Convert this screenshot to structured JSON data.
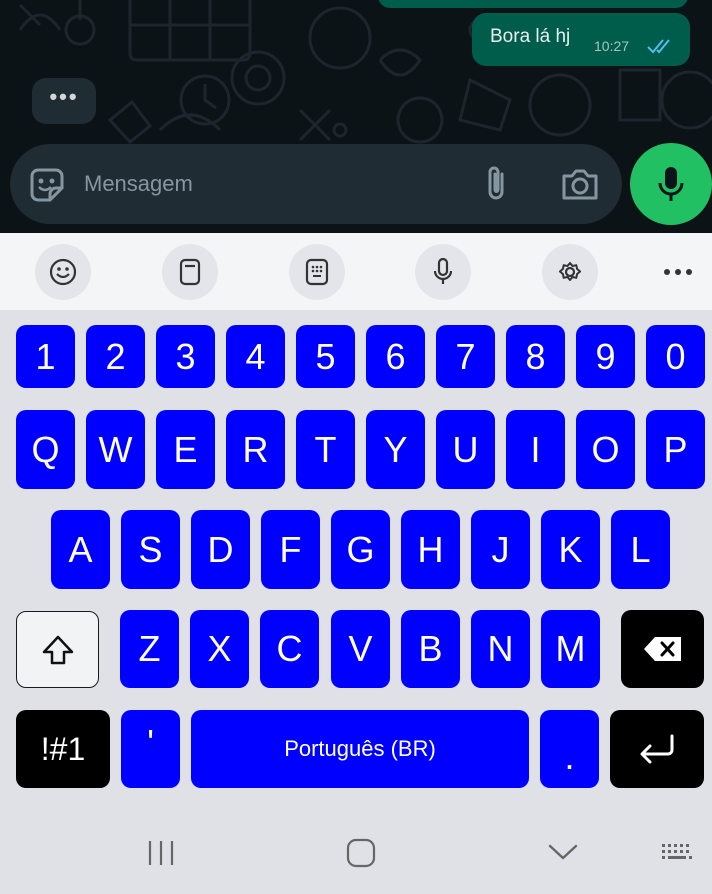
{
  "chat": {
    "outgoing_message": "Bora lá hj",
    "outgoing_time": "10:27",
    "read_status": "double-check-read",
    "typing_indicator": "•••"
  },
  "composer": {
    "placeholder": "Mensagem",
    "icons": [
      "sticker-icon",
      "attach-icon",
      "camera-icon",
      "mic-icon"
    ]
  },
  "toolbar": {
    "items": [
      "emoji-icon",
      "clipboard-icon",
      "keypad-icon",
      "voice-input-icon",
      "settings-icon",
      "more-icon"
    ]
  },
  "keyboard": {
    "row_numbers": [
      "1",
      "2",
      "3",
      "4",
      "5",
      "6",
      "7",
      "8",
      "9",
      "0"
    ],
    "row_top": [
      "Q",
      "W",
      "E",
      "R",
      "T",
      "Y",
      "U",
      "I",
      "O",
      "P"
    ],
    "row_middle": [
      "A",
      "S",
      "D",
      "F",
      "G",
      "H",
      "J",
      "K",
      "L"
    ],
    "row_bottom": [
      "Z",
      "X",
      "C",
      "V",
      "B",
      "N",
      "M"
    ],
    "symbols_key": "!#1",
    "apostrophe_key": "'",
    "space_label": "Português (BR)",
    "period_key": ".",
    "icons": [
      "shift-icon",
      "backspace-icon",
      "enter-icon"
    ]
  },
  "colors": {
    "key_blue": "#0000ff",
    "mic_green": "#21c063",
    "bubble_green": "#005c4b",
    "chat_bg": "#0c1317"
  },
  "navbar": {
    "items": [
      "recent-apps-icon",
      "home-icon",
      "back-icon",
      "keyboard-switch-icon"
    ]
  }
}
